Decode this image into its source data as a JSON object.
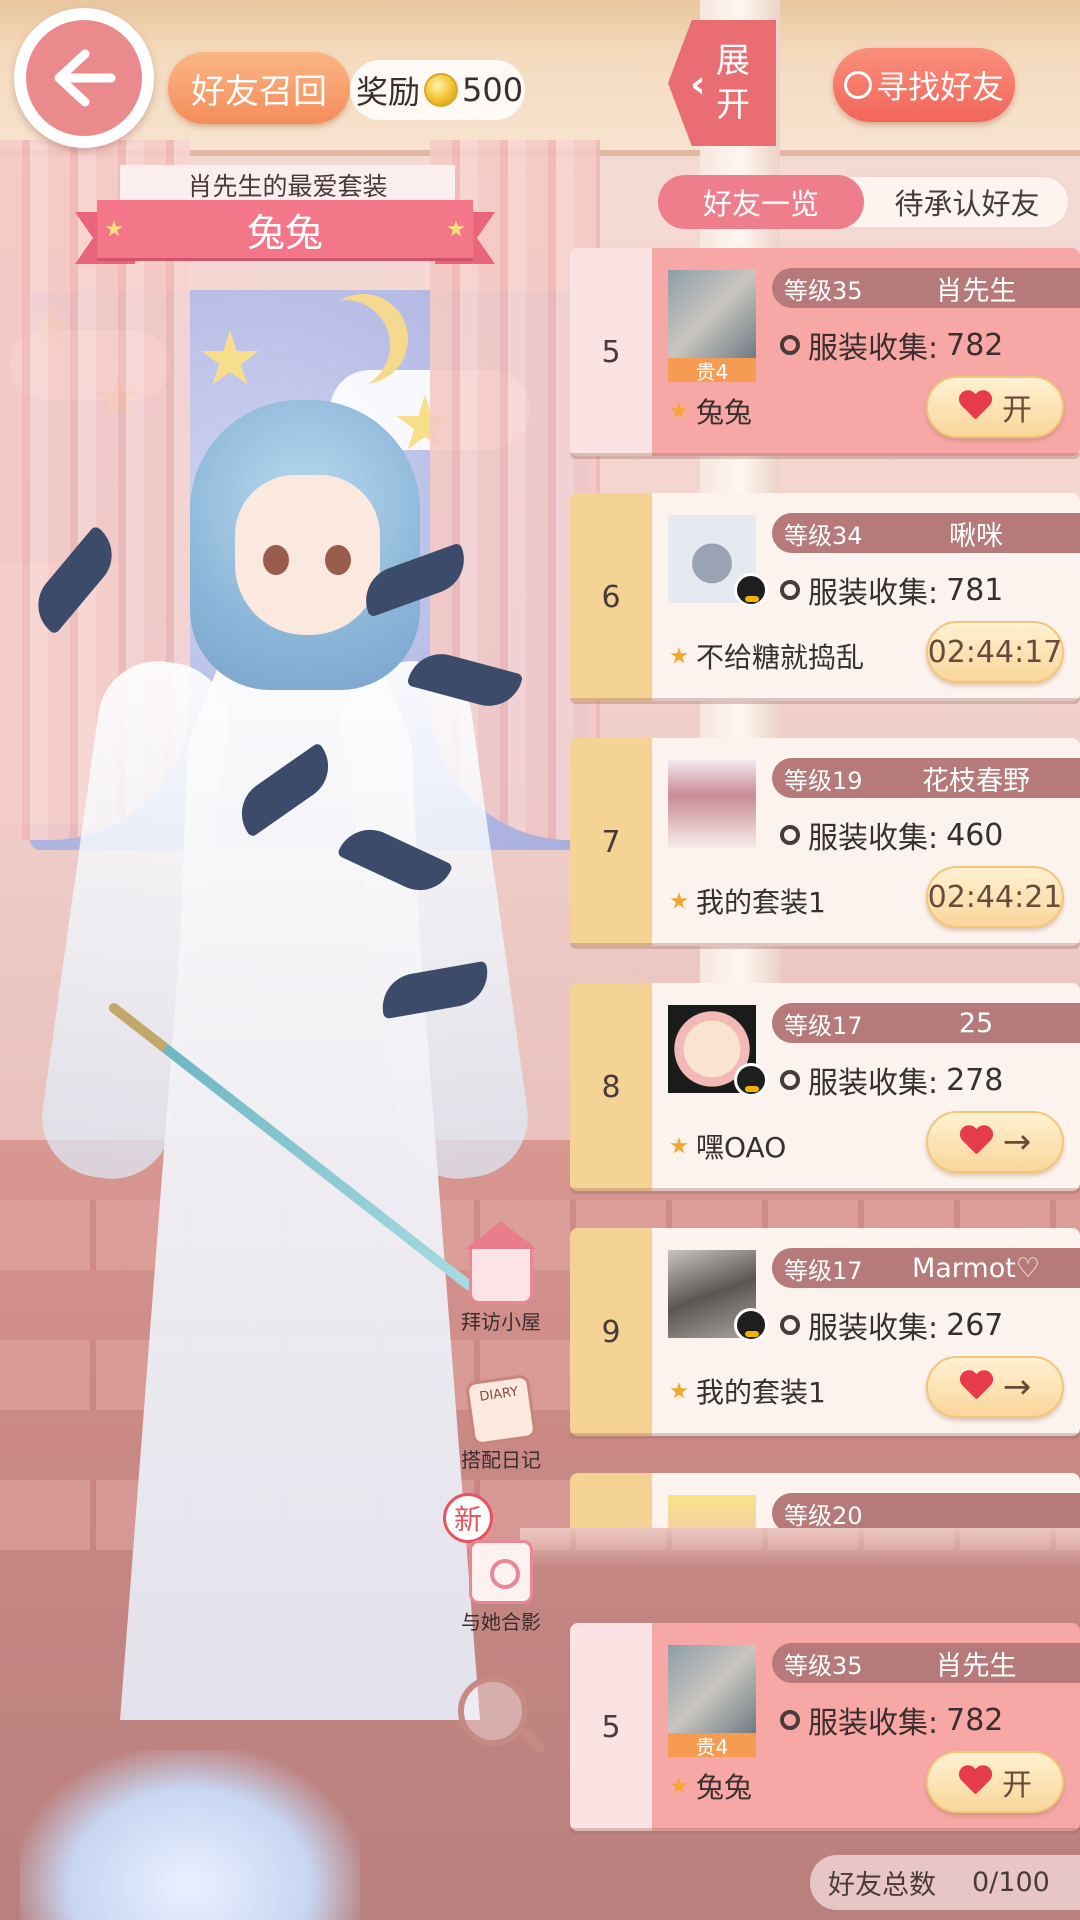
{
  "header": {
    "recall_label": "好友召回",
    "reward_label": "奖励",
    "reward_amount": "500",
    "expand_label_1": "展",
    "expand_label_2": "开",
    "find_friend_label": "寻找好友"
  },
  "outfit": {
    "owner_caption": "肖先生的最爱套装",
    "name": "兔兔"
  },
  "tabs": [
    {
      "label": "好友一览",
      "active": true
    },
    {
      "label": "待承认好友",
      "active": false
    }
  ],
  "friends": [
    {
      "rank": "5",
      "level": "等级35",
      "name": "肖先生",
      "collect_label": "服装收集:",
      "collect_value": "782",
      "suit": "兔兔",
      "vip": "贵4",
      "action": "开"
    },
    {
      "rank": "6",
      "level": "等级34",
      "name": "啾咪",
      "collect_label": "服装收集:",
      "collect_value": "781",
      "suit": "不给糖就捣乱",
      "action": "02:44:17"
    },
    {
      "rank": "7",
      "level": "等级19",
      "name": "花枝春野",
      "collect_label": "服装收集:",
      "collect_value": "460",
      "suit": "我的套装1",
      "action": "02:44:21"
    },
    {
      "rank": "8",
      "level": "等级17",
      "name": "25",
      "collect_label": "服装收集:",
      "collect_value": "278",
      "suit": "嘿OAO",
      "action": "→"
    },
    {
      "rank": "9",
      "level": "等级17",
      "name": "Marmot♡",
      "collect_label": "服装收集:",
      "collect_value": "267",
      "suit": "我的套装1",
      "action": "→"
    },
    {
      "rank": "",
      "level": "等级20",
      "name": "",
      "collect_label": "",
      "collect_value": "",
      "suit": "",
      "action": ""
    }
  ],
  "self_card": {
    "rank": "5",
    "level": "等级35",
    "name": "肖先生",
    "collect_label": "服装收集:",
    "collect_value": "782",
    "suit": "兔兔",
    "vip": "贵4",
    "action": "开"
  },
  "side_actions": {
    "visit_house": "拜访小屋",
    "diary": "搭配日记",
    "diary_cover": "DIARY",
    "new_badge": "新",
    "photo": "与她合影"
  },
  "footer": {
    "total_label": "好友总数",
    "total_value": "0/100"
  },
  "colors": {
    "accent_pink": "#ef7e8c",
    "highlight_card": "#f7a8a6",
    "rank_gold": "#f5d394",
    "level_bar": "#b57a79",
    "coin": "#f2c12e"
  }
}
